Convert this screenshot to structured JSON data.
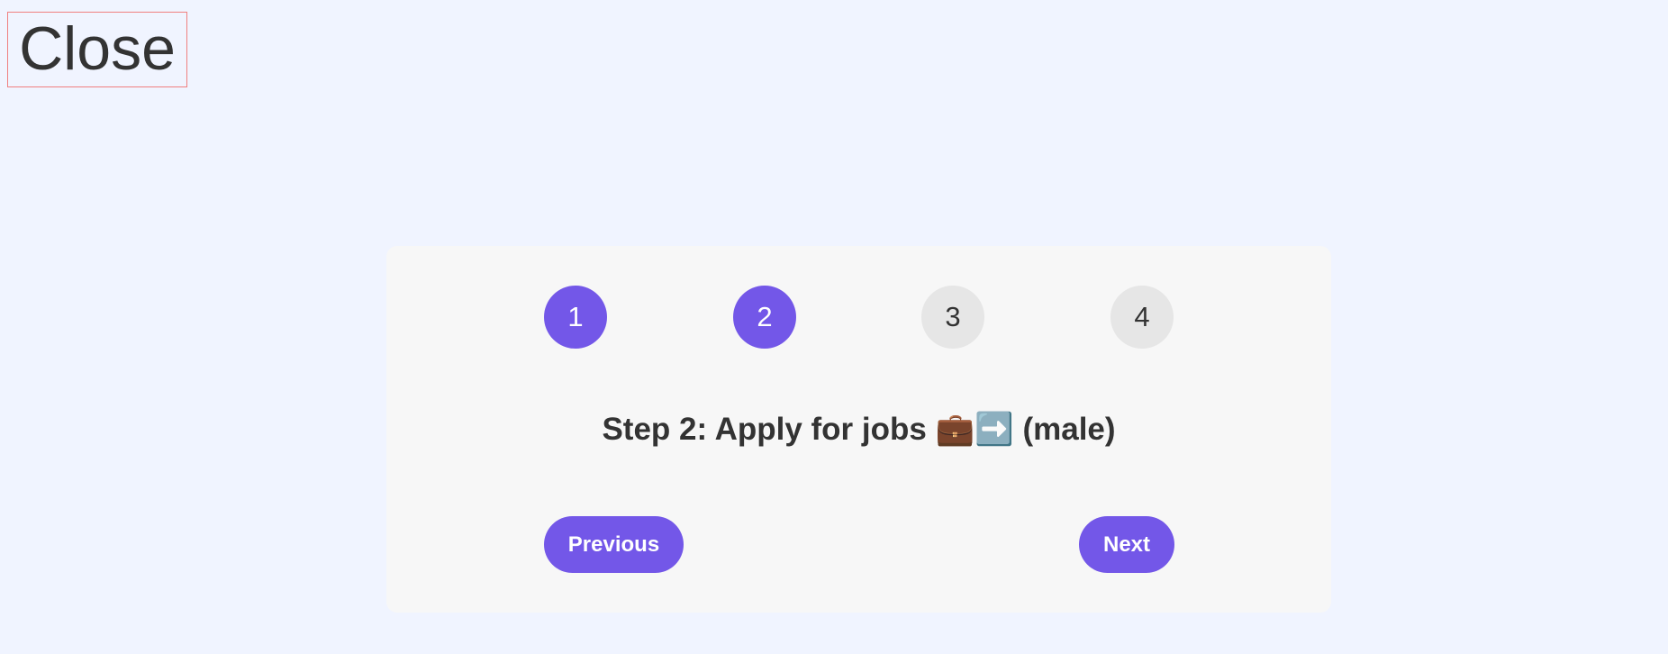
{
  "close_label": "Close",
  "steps": [
    {
      "label": "1",
      "state": "active"
    },
    {
      "label": "2",
      "state": "active"
    },
    {
      "label": "3",
      "state": "inactive"
    },
    {
      "label": "4",
      "state": "inactive"
    }
  ],
  "current_step": 2,
  "step_title": "Step 2: Apply for jobs 💼➡️ (male)",
  "buttons": {
    "previous_label": "Previous",
    "next_label": "Next"
  },
  "colors": {
    "accent": "#7357e8",
    "inactive_step": "#e6e6e6",
    "page_background": "#f0f4ff",
    "card_background": "#f7f7f7",
    "close_border": "#f08080"
  }
}
